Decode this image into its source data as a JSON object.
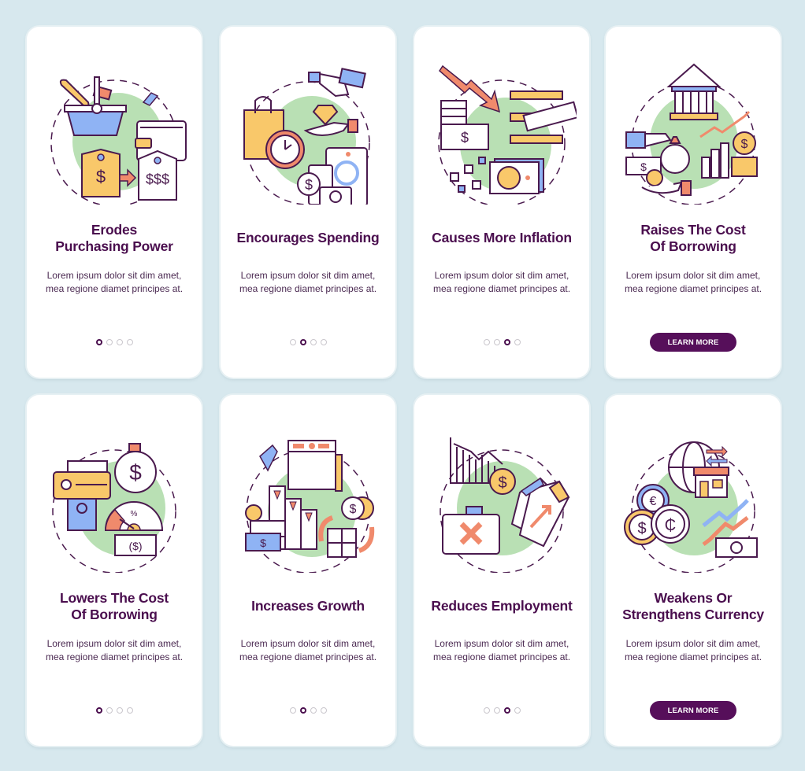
{
  "colors": {
    "background": "#d7e8ee",
    "card": "#ffffff",
    "title": "#4a0e4e",
    "button": "#560f5a",
    "outline": "#4a1a4e",
    "green_blob": "#b9e0b4",
    "yellow": "#f9c86a",
    "blue": "#8fb3f4",
    "coral": "#f08a6c"
  },
  "screens": [
    {
      "title_lines": [
        "Erodes",
        "Purchasing Power"
      ],
      "description": "Lorem ipsum dolor sit dim amet, mea regione diamet principes at.",
      "illustration": "shopping-basket-wallet-price-tags",
      "pager": {
        "total": 4,
        "active": 1
      },
      "button": null
    },
    {
      "title_lines": [
        "Encourages Spending"
      ],
      "description": "Lorem ipsum dolor sit dim amet, mea regione diamet principes at.",
      "illustration": "shopping-bag-stopwatch-diamond-appliances",
      "pager": {
        "total": 4,
        "active": 2
      },
      "button": null
    },
    {
      "title_lines": [
        "Causes More Inflation"
      ],
      "description": "Lorem ipsum dolor sit dim amet, mea regione diamet principes at.",
      "illustration": "falling-arrow-cash-stack-gold-bars",
      "pager": {
        "total": 4,
        "active": 3
      },
      "button": null
    },
    {
      "title_lines": [
        "Raises The Cost",
        "Of Borrowing"
      ],
      "description": "Lorem ipsum dolor sit dim amet, mea regione diamet principes at.",
      "illustration": "bank-money-bag-rising-chart",
      "pager": null,
      "button": "LEARN MORE"
    },
    {
      "title_lines": [
        "Lowers The Cost",
        "Of Borrowing"
      ],
      "description": "Lorem ipsum dolor sit dim amet, mea regione diamet principes at.",
      "illustration": "cash-printer-money-bomb-rate-gauge",
      "pager": {
        "total": 4,
        "active": 1
      },
      "button": null
    },
    {
      "title_lines": [
        "Increases Growth"
      ],
      "description": "Lorem ipsum dolor sit dim amet, mea regione diamet principes at.",
      "illustration": "browser-window-cash-boxes-exchange",
      "pager": {
        "total": 4,
        "active": 2
      },
      "button": null
    },
    {
      "title_lines": [
        "Reduces Employment"
      ],
      "description": "Lorem ipsum dolor sit dim amet, mea regione diamet principes at.",
      "illustration": "falling-chart-briefcase-x-price-tags",
      "pager": {
        "total": 4,
        "active": 3
      },
      "button": null
    },
    {
      "title_lines": [
        "Weakens Or",
        "Strengthens Currency"
      ],
      "description": "Lorem ipsum dolor sit dim amet, mea regione diamet principes at.",
      "illustration": "globe-store-currency-coins-arrows",
      "pager": null,
      "button": "LEARN MORE"
    }
  ]
}
